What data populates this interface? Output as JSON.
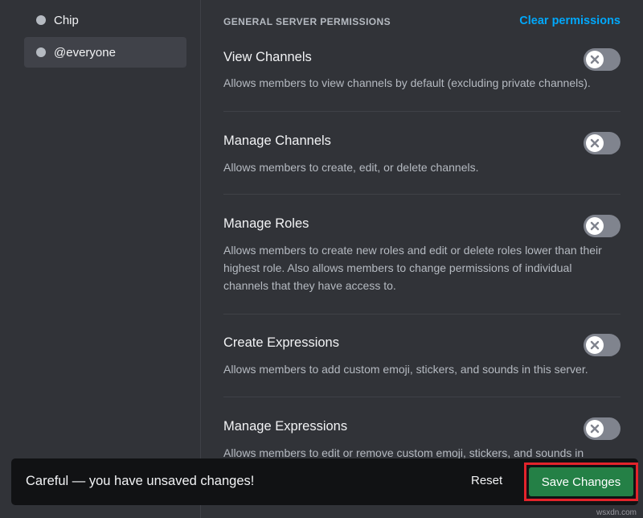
{
  "sidebar": {
    "roles": [
      {
        "label": "Chip",
        "selected": false
      },
      {
        "label": "@everyone",
        "selected": true
      }
    ]
  },
  "main": {
    "section_title": "GENERAL SERVER PERMISSIONS",
    "clear_label": "Clear permissions",
    "permissions": [
      {
        "name": "View Channels",
        "description": "Allows members to view channels by default (excluding private channels).",
        "enabled": false
      },
      {
        "name": "Manage Channels",
        "description": "Allows members to create, edit, or delete channels.",
        "enabled": false
      },
      {
        "name": "Manage Roles",
        "description": "Allows members to create new roles and edit or delete roles lower than their highest role. Also allows members to change permissions of individual channels that they have access to.",
        "enabled": false
      },
      {
        "name": "Create Expressions",
        "description": "Allows members to add custom emoji, stickers, and sounds in this server.",
        "enabled": false
      },
      {
        "name": "Manage Expressions",
        "description": "Allows members to edit or remove custom emoji, stickers, and sounds in",
        "enabled": false
      }
    ]
  },
  "notice": {
    "text": "Careful — you have unsaved changes!",
    "reset_label": "Reset",
    "save_label": "Save Changes"
  },
  "watermark": "wsxdn.com",
  "colors": {
    "background": "#313338",
    "accent_link": "#00a8fc",
    "save_green": "#248046",
    "highlight_red": "#e3242b",
    "toggle_off": "#80848e"
  },
  "icons": {
    "role_dot": "circle-icon",
    "toggle_knob": "x-icon"
  }
}
